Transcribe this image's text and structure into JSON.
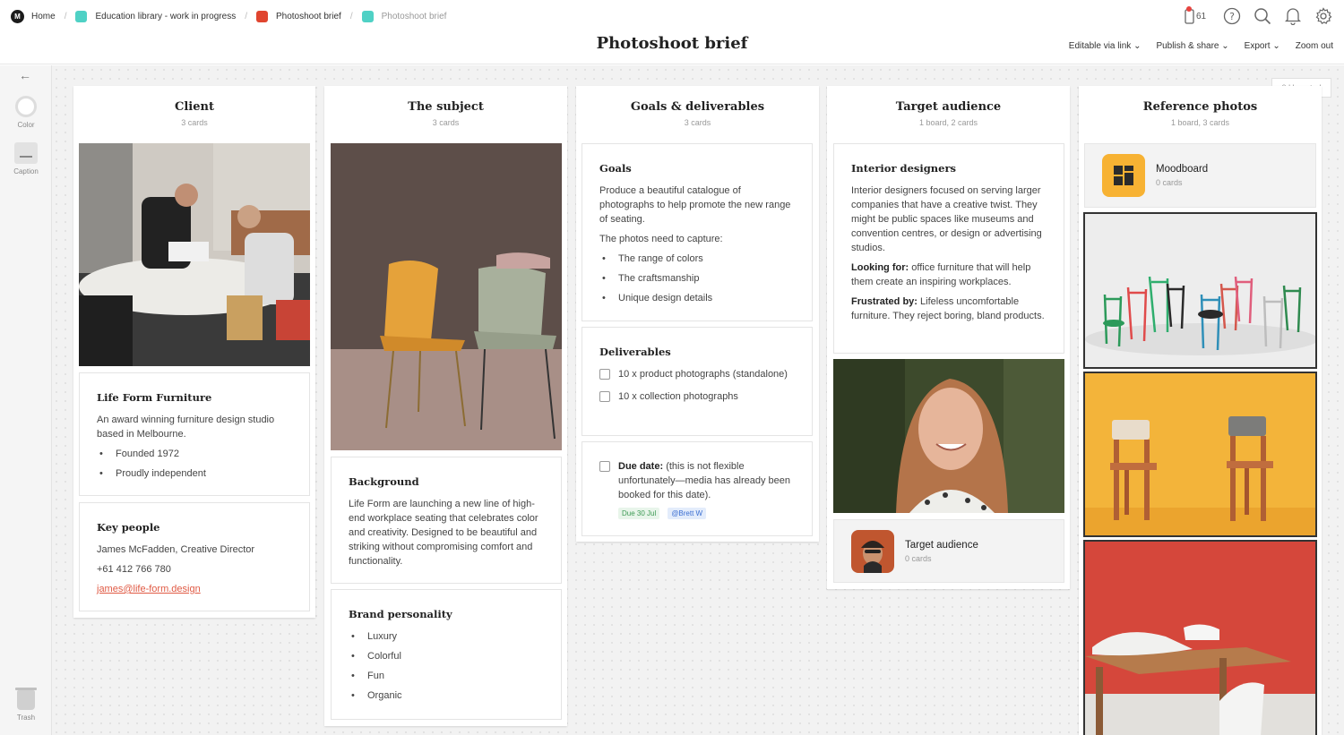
{
  "breadcrumbs": [
    {
      "label": "Home",
      "color": "#1b1b1b"
    },
    {
      "label": "Education library - work in progress",
      "color": "#4fd1c5"
    },
    {
      "label": "Photoshoot brief",
      "color": "#e0452f"
    },
    {
      "label": "Photoshoot brief",
      "color": "#4fd1c5"
    }
  ],
  "header": {
    "notification_count": "61",
    "title": "Photoshoot brief",
    "menu": [
      "Editable via link",
      "Publish & share",
      "Export",
      "Zoom out"
    ]
  },
  "toolbar": {
    "color_label": "Color",
    "caption_label": "Caption",
    "trash_label": "Trash"
  },
  "unsorted": "0 Unsorted",
  "columns": {
    "client": {
      "title": "Client",
      "count": "3 cards",
      "company": {
        "title": "Life Form Furniture",
        "desc": "An award winning furniture design studio based in Melbourne.",
        "bullets": [
          "Founded 1972",
          "Proudly independent"
        ]
      },
      "people": {
        "title": "Key people",
        "line1": "James McFadden, Creative Director",
        "phone": "+61 412 766 780",
        "email": "james@life-form.design"
      }
    },
    "subject": {
      "title": "The subject",
      "count": "3 cards",
      "background": {
        "title": "Background",
        "text": "Life Form are launching a new line of high-end workplace seating that celebrates color and creativity. Designed to be beautiful and striking without compromising comfort and functionality."
      },
      "personality": {
        "title": "Brand personality",
        "bullets": [
          "Luxury",
          "Colorful",
          "Fun",
          "Organic"
        ]
      }
    },
    "goals": {
      "title": "Goals & deliverables",
      "count": "3 cards",
      "goals_card": {
        "title": "Goals",
        "text": "Produce a beautiful catalogue of photographs to help promote the new range of seating.",
        "capture": "The photos need to capture:",
        "bullets": [
          "The range of colors",
          "The craftsmanship",
          "Unique design details"
        ]
      },
      "deliverables": {
        "title": "Deliverables",
        "items": [
          "10 x product photographs (standalone)",
          "10 x collection photographs"
        ]
      },
      "due": {
        "label": "Due date:",
        "text": "(this is not flexible unfortunately—media has already been booked for this date).",
        "date_tag": "Due 30 Jul",
        "user_tag": "@Brett W"
      }
    },
    "target": {
      "title": "Target audience",
      "count": "1 board, 2 cards",
      "designers": {
        "title": "Interior designers",
        "text": "Interior designers focused on serving larger companies that have a creative twist. They might be public spaces like museums and convention centres, or design or advertising studios.",
        "looking_label": "Looking for:",
        "looking_text": "office furniture that will help them create an inspiring workplaces.",
        "frustrated_label": "Frustrated by:",
        "frustrated_text": "Lifeless uncomfortable furniture. They reject boring, bland products."
      },
      "board": {
        "title": "Target audience",
        "count": "0 cards"
      }
    },
    "reference": {
      "title": "Reference photos",
      "count": "1 board, 3 cards",
      "board": {
        "title": "Moodboard",
        "count": "0 cards"
      }
    }
  }
}
